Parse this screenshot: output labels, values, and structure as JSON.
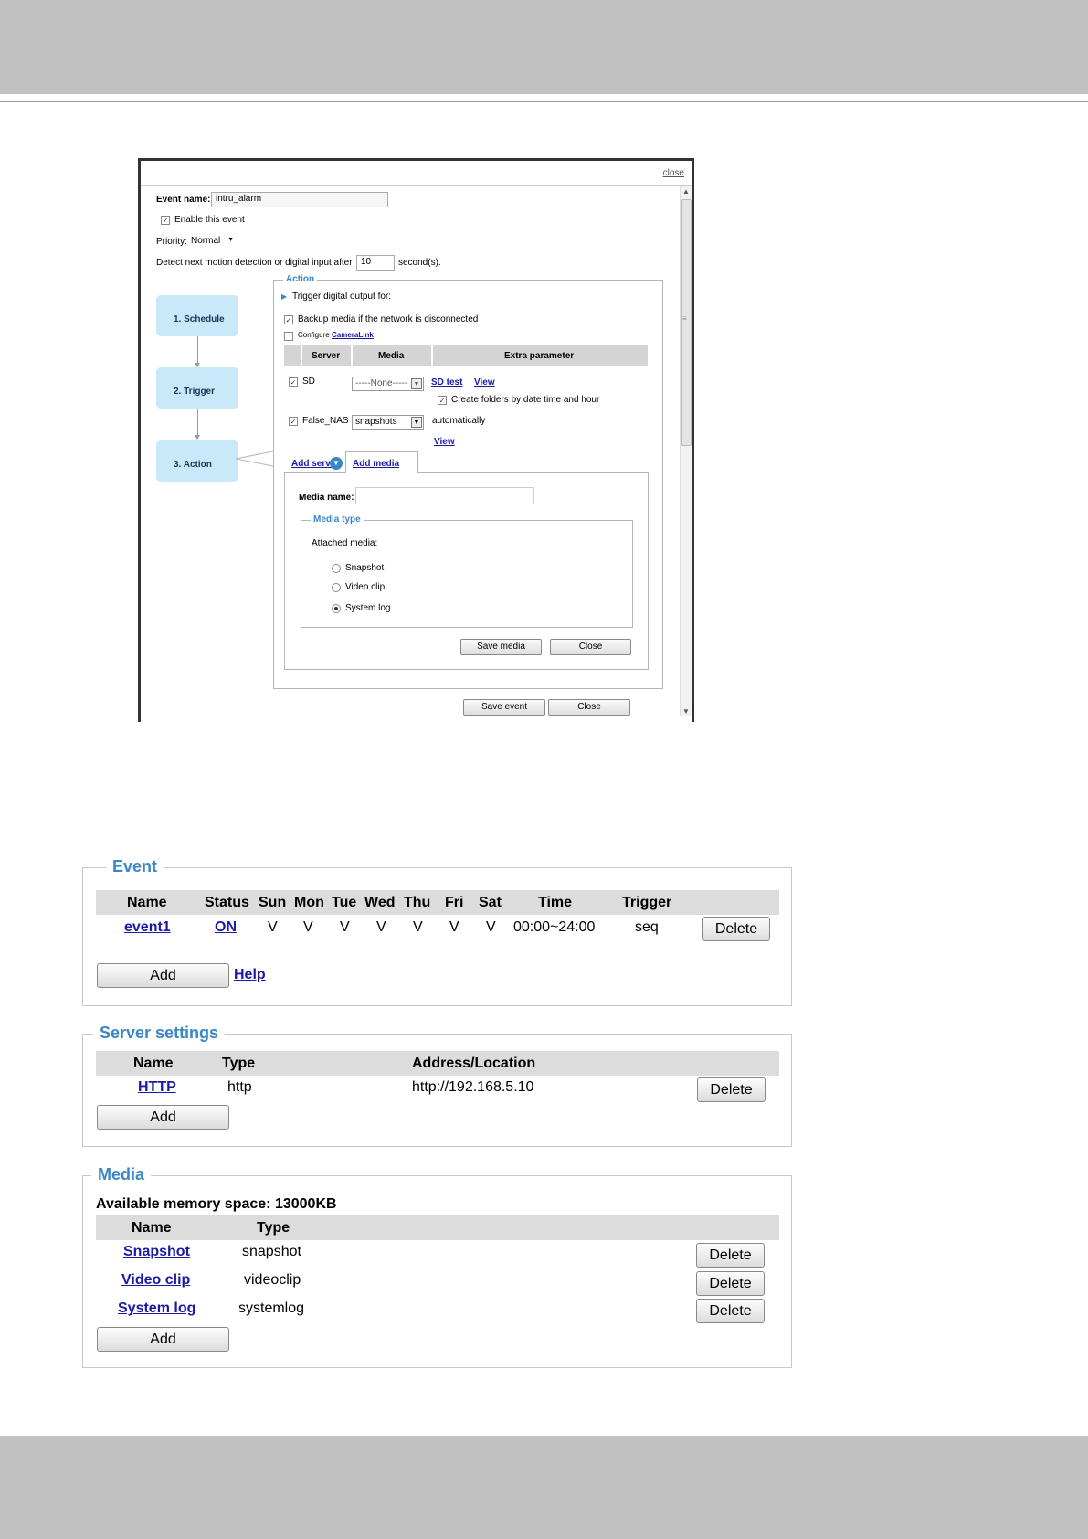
{
  "dialog": {
    "close_label": "close",
    "event_name_label": "Event name:",
    "event_name_value": "intru_alarm",
    "enable_label": "Enable this event",
    "priority_label": "Priority:",
    "priority_value": "Normal",
    "detect_label": "Detect next motion detection or digital input after",
    "detect_value": "10",
    "detect_unit": "second(s).",
    "steps": [
      "1.  Schedule",
      "2.  Trigger",
      "3.  Action"
    ],
    "action_legend": "Action",
    "trigger_output_label": "Trigger digital output for:",
    "backup_label": "Backup media if the network is disconnected",
    "configure_label": "Configure",
    "camera_link_label": "CameraLink",
    "table_headers": [
      "Server",
      "Media",
      "Extra parameter"
    ],
    "rows": [
      {
        "server": "SD",
        "media": "-----None-----",
        "link1": "SD test",
        "link2": "View",
        "extra": "Create folders by date time and hour"
      },
      {
        "server": "False_NAS",
        "media": "snapshots",
        "extra": "automatically",
        "link2": "View"
      }
    ],
    "tab_add_server": "Add server",
    "tab_add_media": "Add media",
    "media_name_label": "Media name:",
    "media_type_legend": "Media type",
    "attached_media_label": "Attached media:",
    "media_options": [
      "Snapshot",
      "Video clip",
      "System log"
    ],
    "media_selected": "System log",
    "save_media_label": "Save media",
    "close_media_label": "Close",
    "save_event_label": "Save event",
    "close_event_label": "Close"
  },
  "event_panel": {
    "title": "Event",
    "headers": [
      "Name",
      "Status",
      "Sun",
      "Mon",
      "Tue",
      "Wed",
      "Thu",
      "Fri",
      "Sat",
      "Time",
      "Trigger"
    ],
    "row": {
      "name": "event1",
      "status": "ON",
      "days": [
        "V",
        "V",
        "V",
        "V",
        "V",
        "V",
        "V"
      ],
      "time": "00:00~24:00",
      "trigger": "seq"
    },
    "delete_label": "Delete",
    "add_label": "Add",
    "help_label": "Help"
  },
  "server_panel": {
    "title": "Server settings",
    "headers": [
      "Name",
      "Type",
      "Address/Location"
    ],
    "row": {
      "name": "HTTP",
      "type": "http",
      "address": "http://192.168.5.10"
    },
    "delete_label": "Delete",
    "add_label": "Add"
  },
  "media_panel": {
    "title": "Media",
    "memory_label": "Available memory space: 13000KB",
    "headers": [
      "Name",
      "Type"
    ],
    "rows": [
      {
        "name": "Snapshot",
        "type": "snapshot"
      },
      {
        "name": "Video clip",
        "type": "videoclip"
      },
      {
        "name": "System log",
        "type": "systemlog"
      }
    ],
    "delete_label": "Delete",
    "add_label": "Add"
  }
}
